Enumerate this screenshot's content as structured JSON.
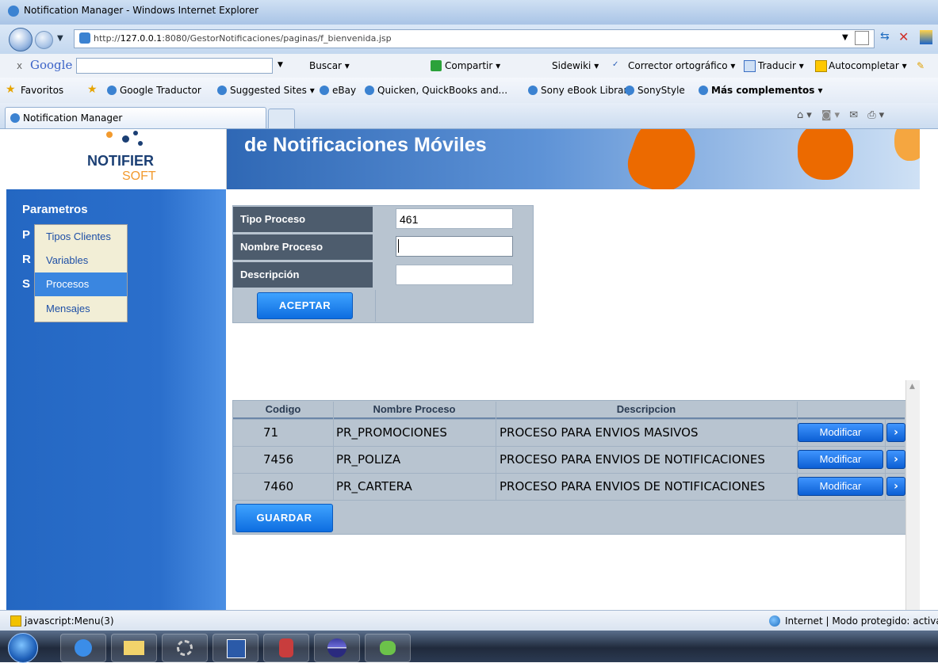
{
  "window": {
    "title": "Notification Manager - Windows Internet Explorer",
    "url_prefix": "http://",
    "url_host": "127.0.0.1",
    "url_rest": ":8080/GestorNotificaciones/paginas/f_bienvenida.jsp"
  },
  "google_toolbar": {
    "close": "x",
    "brand": "Google",
    "buscar": "Buscar ▾",
    "compartir": "Compartir ▾",
    "sidewiki": "Sidewiki ▾",
    "corrector": "Corrector ortográfico ▾",
    "traducir": "Traducir ▾",
    "autocompletar": "Autocompletar ▾"
  },
  "favorites_bar": {
    "favoritos": "Favoritos",
    "items": [
      "Google Traductor",
      "Suggested Sites ▾",
      "eBay",
      "Quicken, QuickBooks and...",
      "Sony eBook Library",
      "SonyStyle"
    ],
    "more": "Más complementos ▾"
  },
  "tab": {
    "label": "Notification Manager"
  },
  "logo": {
    "line1": "NOTIFIER",
    "line2": "SOFT"
  },
  "banner": {
    "title": "de Notificaciones Móviles"
  },
  "sidebar": {
    "menu": [
      "Parametros",
      "P",
      "R",
      "S"
    ],
    "dropdown": [
      "Tipos Clientes",
      "Variables",
      "Procesos",
      "Mensajes"
    ]
  },
  "form": {
    "labels": [
      "Tipo Proceso",
      "Nombre Proceso",
      "Descripción"
    ],
    "values": [
      "461",
      "",
      ""
    ],
    "accept": "ACEPTAR"
  },
  "table": {
    "headers": [
      "Codigo",
      "Nombre Proceso",
      "Descripcion"
    ],
    "rows": [
      [
        "71",
        "PR_PROMOCIONES",
        "PROCESO PARA ENVIOS MASIVOS"
      ],
      [
        "7456",
        "PR_POLIZA",
        "PROCESO PARA ENVIOS DE NOTIFICACIONES"
      ],
      [
        "7460",
        "PR_CARTERA",
        "PROCESO PARA ENVIOS DE NOTIFICACIONES"
      ]
    ],
    "modify": "Modificar",
    "save": "GUARDAR"
  },
  "statusbar": {
    "left": "javascript:Menu(3)",
    "right": "Internet | Modo protegido: activa"
  }
}
